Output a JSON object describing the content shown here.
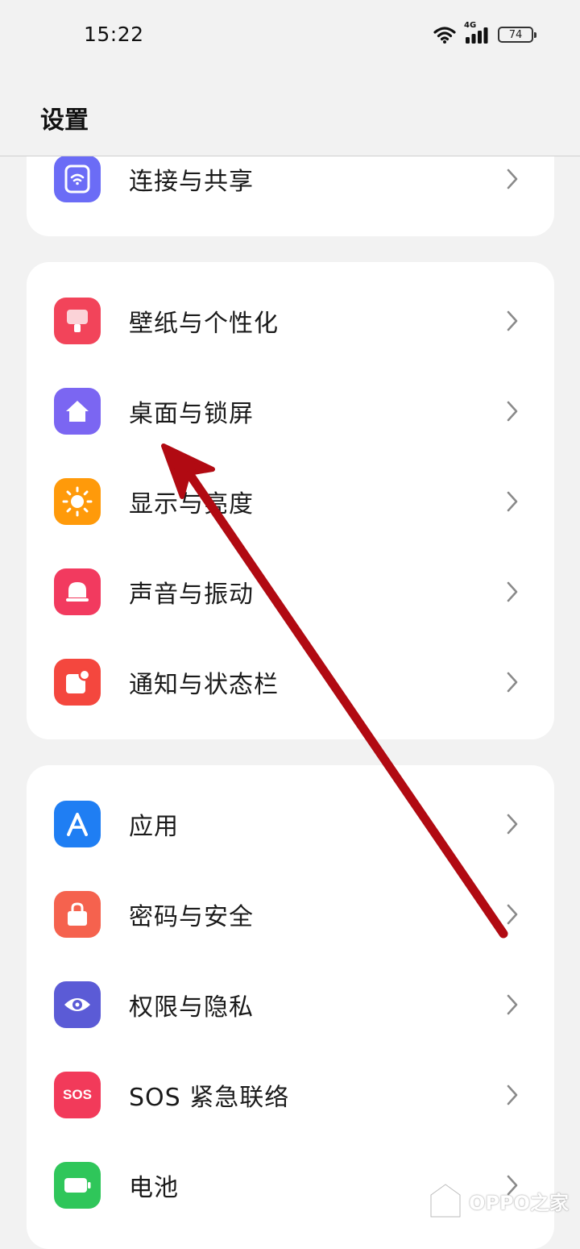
{
  "status_bar": {
    "time": "15:22",
    "network": "4G",
    "battery": "74"
  },
  "header": {
    "title": "设置"
  },
  "groups": [
    {
      "items": [
        {
          "label": "连接与共享",
          "icon": "wifi-share-icon",
          "color": "#6b6cf6"
        }
      ]
    },
    {
      "items": [
        {
          "label": "壁纸与个性化",
          "icon": "wallpaper-brush-icon",
          "color": "#f2445a"
        },
        {
          "label": "桌面与锁屏",
          "icon": "home-icon",
          "color": "#7b66f2"
        },
        {
          "label": "显示与亮度",
          "icon": "sun-icon",
          "color": "#ff9a0a"
        },
        {
          "label": "声音与振动",
          "icon": "bell-icon",
          "color": "#f23a5f"
        },
        {
          "label": "通知与状态栏",
          "icon": "notification-icon",
          "color": "#f4473e"
        }
      ]
    },
    {
      "items": [
        {
          "label": "应用",
          "icon": "app-store-icon",
          "color": "#1f7ef3"
        },
        {
          "label": "密码与安全",
          "icon": "lock-bag-icon",
          "color": "#f5624e"
        },
        {
          "label": "权限与隐私",
          "icon": "eye-icon",
          "color": "#5b5bd6"
        },
        {
          "label": "SOS 紧急联络",
          "icon": "sos-icon",
          "color": "#f23a5a",
          "icon_text": "SOS"
        },
        {
          "label": "电池",
          "icon": "battery-icon",
          "color": "#2fc65a"
        }
      ]
    }
  ],
  "watermark": {
    "text": "OPPO之家"
  },
  "annotation": {
    "color": "#b10a12"
  }
}
